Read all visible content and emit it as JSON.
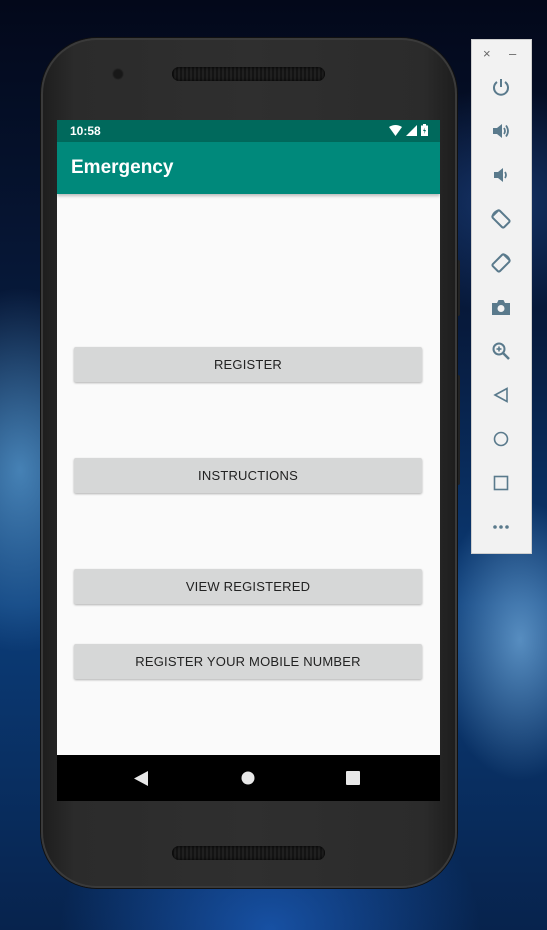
{
  "status_bar": {
    "time": "10:58",
    "icons": [
      "wifi-icon",
      "signal-icon",
      "battery-icon"
    ]
  },
  "app_bar": {
    "title": "Emergency",
    "color": "#00897b",
    "status_color": "#00695c"
  },
  "buttons": {
    "register": "REGISTER",
    "instructions": "INSTRUCTIONS",
    "view_registered": "VIEW REGISTERED",
    "register_mobile": "REGISTER YOUR MOBILE NUMBER"
  },
  "nav_bar": {
    "icons": [
      "back-icon",
      "home-icon",
      "recents-icon"
    ]
  },
  "emulator_panel": {
    "window_controls": {
      "close": "×",
      "minimize": "–"
    },
    "icons": [
      "power-icon",
      "volume-up-icon",
      "volume-down-icon",
      "rotate-left-icon",
      "rotate-right-icon",
      "camera-icon",
      "zoom-icon",
      "back-icon",
      "home-icon",
      "overview-icon",
      "more-icon"
    ],
    "icon_color": "#5a7a8c"
  }
}
